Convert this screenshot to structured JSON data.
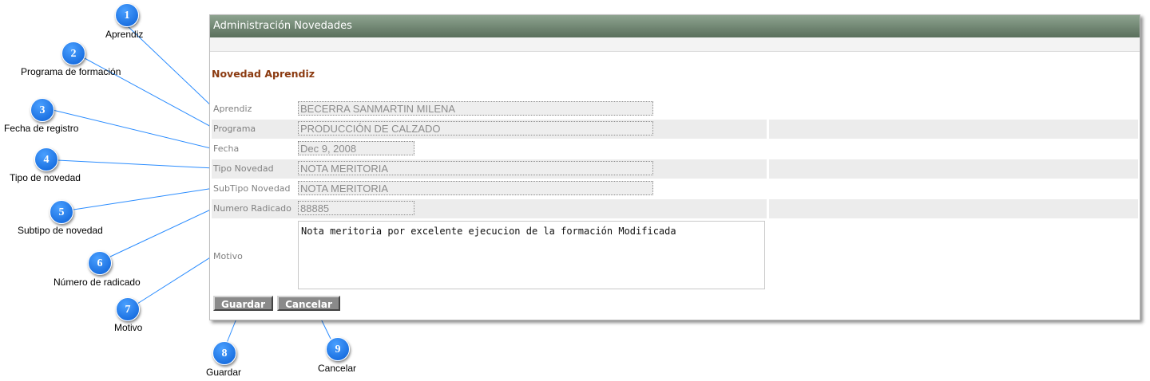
{
  "panel": {
    "title": "Administración Novedades",
    "section_title": "Novedad Aprendiz"
  },
  "form": {
    "aprendiz": {
      "label": "Aprendiz",
      "value": "BECERRA SANMARTIN MILENA"
    },
    "programa": {
      "label": "Programa",
      "value": "PRODUCCIÓN DE CALZADO"
    },
    "fecha": {
      "label": "Fecha",
      "value": "Dec 9, 2008"
    },
    "tipo_novedad": {
      "label": "Tipo Novedad",
      "value": "NOTA MERITORIA"
    },
    "subtipo_novedad": {
      "label": "SubTipo Novedad",
      "value": "NOTA MERITORIA"
    },
    "numero_radicado": {
      "label": "Numero Radicado",
      "value": "88885"
    },
    "motivo": {
      "label": "Motivo",
      "value": "Nota meritoria por excelente ejecucion de la formación Modificada"
    }
  },
  "buttons": {
    "guardar": "Guardar",
    "cancelar": "Cancelar"
  },
  "callouts": [
    {
      "number": "1",
      "label": "Aprendiz"
    },
    {
      "number": "2",
      "label": "Programa de formación"
    },
    {
      "number": "3",
      "label": "Fecha de registro"
    },
    {
      "number": "4",
      "label": "Tipo de novedad"
    },
    {
      "number": "5",
      "label": "Subtipo de novedad"
    },
    {
      "number": "6",
      "label": "Número de radicado"
    },
    {
      "number": "7",
      "label": "Motivo"
    },
    {
      "number": "8",
      "label": "Guardar"
    },
    {
      "number": "9",
      "label": "Cancelar"
    }
  ],
  "colors": {
    "header_bg": "#6f8571",
    "section_title": "#8b3a10",
    "callout": "#1a73e8",
    "button_bg": "#8a8a8a"
  }
}
